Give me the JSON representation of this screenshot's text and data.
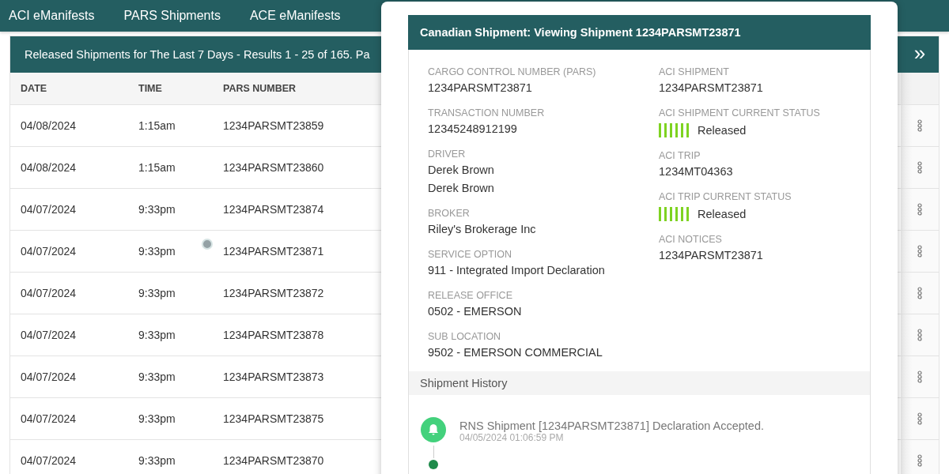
{
  "nav": {
    "items": [
      {
        "label": "ACI eManifests",
        "selected": false
      },
      {
        "label": "PARS Shipments",
        "selected": false
      },
      {
        "label": "ACE eManifests",
        "selected": false
      }
    ]
  },
  "panel": {
    "title": "Released Shipments for The Last 7 Days - Results 1 - 25 of 165. Pa",
    "expand_icon": "»"
  },
  "table": {
    "columns": [
      "DATE",
      "TIME",
      "PARS NUMBER"
    ],
    "rows": [
      {
        "date": "04/08/2024",
        "time": "1:15am",
        "pars": "1234PARSMT23859",
        "pointer": false
      },
      {
        "date": "04/08/2024",
        "time": "1:15am",
        "pars": "1234PARSMT23860",
        "pointer": false
      },
      {
        "date": "04/07/2024",
        "time": "9:33pm",
        "pars": "1234PARSMT23874",
        "pointer": false
      },
      {
        "date": "04/07/2024",
        "time": "9:33pm",
        "pars": "1234PARSMT23871",
        "pointer": true
      },
      {
        "date": "04/07/2024",
        "time": "9:33pm",
        "pars": "1234PARSMT23872",
        "pointer": false
      },
      {
        "date": "04/07/2024",
        "time": "9:33pm",
        "pars": "1234PARSMT23878",
        "pointer": false
      },
      {
        "date": "04/07/2024",
        "time": "9:33pm",
        "pars": "1234PARSMT23873",
        "pointer": false
      },
      {
        "date": "04/07/2024",
        "time": "9:33pm",
        "pars": "1234PARSMT23875",
        "pointer": false
      },
      {
        "date": "04/07/2024",
        "time": "9:33pm",
        "pars": "1234PARSMT23870",
        "pointer": false
      }
    ]
  },
  "modal": {
    "title": "Canadian Shipment: Viewing Shipment 1234PARSMT23871",
    "left_fields": [
      {
        "kind": "text",
        "label": "CARGO CONTROL NUMBER (PARS)",
        "values": [
          "1234PARSMT23871"
        ]
      },
      {
        "kind": "text",
        "label": "TRANSACTION NUMBER",
        "values": [
          "12345248912199"
        ]
      },
      {
        "kind": "text",
        "label": "DRIVER",
        "values": [
          "Derek Brown",
          "Derek Brown"
        ]
      },
      {
        "kind": "text",
        "label": "BROKER",
        "values": [
          "Riley's Brokerage Inc"
        ]
      },
      {
        "kind": "text",
        "label": "SERVICE OPTION",
        "values": [
          "911 - Integrated Import Declaration"
        ]
      },
      {
        "kind": "text",
        "label": "RELEASE OFFICE",
        "values": [
          "0502 - EMERSON"
        ]
      },
      {
        "kind": "text",
        "label": "SUB LOCATION",
        "values": [
          "9502 - EMERSON COMMERCIAL"
        ]
      }
    ],
    "right_fields": [
      {
        "kind": "text",
        "label": "ACI SHIPMENT",
        "values": [
          "1234PARSMT23871"
        ]
      },
      {
        "kind": "status",
        "label": "ACI SHIPMENT CURRENT STATUS",
        "values": [
          "Released"
        ],
        "color": "#7ed321"
      },
      {
        "kind": "text",
        "label": "ACI TRIP",
        "values": [
          "1234MT04363"
        ]
      },
      {
        "kind": "status",
        "label": "ACI TRIP CURRENT STATUS",
        "values": [
          "Released"
        ],
        "color": "#7ed321"
      },
      {
        "kind": "text",
        "label": "ACI NOTICES",
        "values": [
          "1234PARSMT23871"
        ]
      }
    ],
    "history": {
      "title": "Shipment History",
      "events": [
        {
          "kind": "bell",
          "text": "RNS Shipment [1234PARSMT23871] Declaration Accepted.",
          "time": "04/05/2024 01:06:59 PM"
        },
        {
          "kind": "dot"
        }
      ]
    }
  }
}
